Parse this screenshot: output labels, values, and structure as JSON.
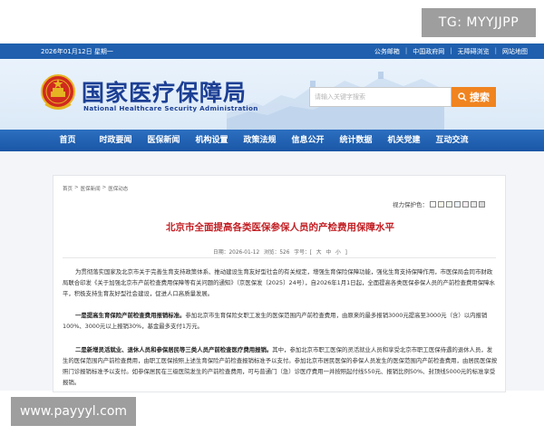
{
  "watermarks": {
    "tg": "TG: MYYJJPP",
    "url": "www.payyyl.com"
  },
  "topbar": {
    "date": "2026年01月12日  星期一",
    "links": [
      "公务邮箱",
      "中国政府网",
      "无障碍浏览",
      "网站地图"
    ]
  },
  "header": {
    "title_cn": "国家医疗保障局",
    "title_en": "National Healthcare Security Administration",
    "search_placeholder": "请输入关键字搜索",
    "search_button": "搜索"
  },
  "nav": {
    "items": [
      "首页",
      "时政要闻",
      "医保新闻",
      "机构设置",
      "政策法规",
      "信息公开",
      "统计数据",
      "机关党建",
      "互动交流"
    ]
  },
  "article": {
    "breadcrumb": [
      "首页",
      "医保新闻",
      "医保动态"
    ],
    "view_protect_label": "视力保护色：",
    "title": "北京市全面提高各类医保参保人员的产检费用保障水平",
    "meta": "日期：2026-01-12  浏览：526  字号：[ 大 中 小 ]",
    "para1": "为贯彻落实国家及北京市关于完善生育支持政策体系、推动建设生育友好型社会的有关规定，增强生育保险保障功能，强化生育支持保障作用，市医保局会同市财政局联合印发《关于加强北京市产前检查费用保障等有关问题的通知》（京医保发〔2025〕24号），自2026年1月1日起，全面提高各类医保参保人员的产前检查费用保障水平，积极支持生育友好型社会建设，促进人口高质量发展。",
    "para2_bold": "一是提高生育保险产前检查费用报销标准。",
    "para2": "参加北京市生育保险女职工发生的医保范围内产前检查费用，由原来的最多报销3000元提高至3000元（含）以内报销100%、3000元以上报销30%，基金最多支付1万元。",
    "para3_bold": "二是新增灵活就业、退休人员和参保居民等三类人员产前检查医疗费用报销。",
    "para3": "其中，参加北京市职工医保的灵活就业人员和享受北京市职工医保待遇的退休人员，发生的医保范围内产前检查费用，由职工医保按照上述生育保险产前检查报销标准予以支付。参加北京市居民医保的参保人员发生的医保范围内产前检查费用，由居民医保按照门诊报销标准予以支付。如参保居民在三级医院发生的产前检查费用，可与普通门（急）诊医疗费用一并按照起付线550元、报销比例50%、封顶线5000元的标准享受报销。"
  },
  "colors": {
    "brand_blue": "#1f5fae",
    "title_red": "#c21f24",
    "search_orange": "#f08420"
  }
}
